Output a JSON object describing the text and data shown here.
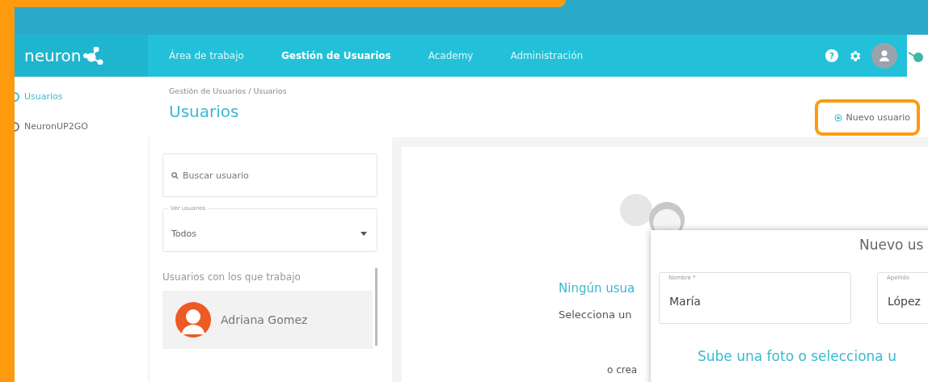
{
  "brand": {
    "name": "neuron"
  },
  "nav": [
    {
      "label": "Área de trabajo",
      "selected": false
    },
    {
      "label": "Gestión de Usuarios",
      "selected": true
    },
    {
      "label": "Academy",
      "selected": false
    },
    {
      "label": "Administración",
      "selected": false
    }
  ],
  "sidebar": {
    "items": [
      {
        "label": "Usuarios",
        "selected": true
      },
      {
        "label": "NeuronUP2GO",
        "selected": false
      }
    ]
  },
  "help": {
    "label": "?"
  },
  "header": {
    "breadcrumb": [
      "Gestión de Usuarios",
      "Usuarios"
    ],
    "breadcrumb_separator": "/",
    "title": "Usuarios",
    "new_button": "Nuevo usuario"
  },
  "filters": {
    "search": {
      "placeholder": "Buscar usuario"
    },
    "select": {
      "label": "Ver usuarios",
      "value": "Todos"
    }
  },
  "user_list": {
    "heading": "Usuarios con los que trabajo",
    "users": [
      {
        "name": "Adriana Gomez",
        "selected": true
      }
    ]
  },
  "empty_state": {
    "title": "Ningún usua",
    "text": "Selecciona un",
    "create_text": "o crea"
  },
  "dialog": {
    "title": "Nuevo us",
    "fields": [
      {
        "label": "Nombre *",
        "value": "María"
      },
      {
        "label": "Apellido",
        "value": "López"
      }
    ],
    "upload_text": "Sube una foto o selecciona u"
  }
}
